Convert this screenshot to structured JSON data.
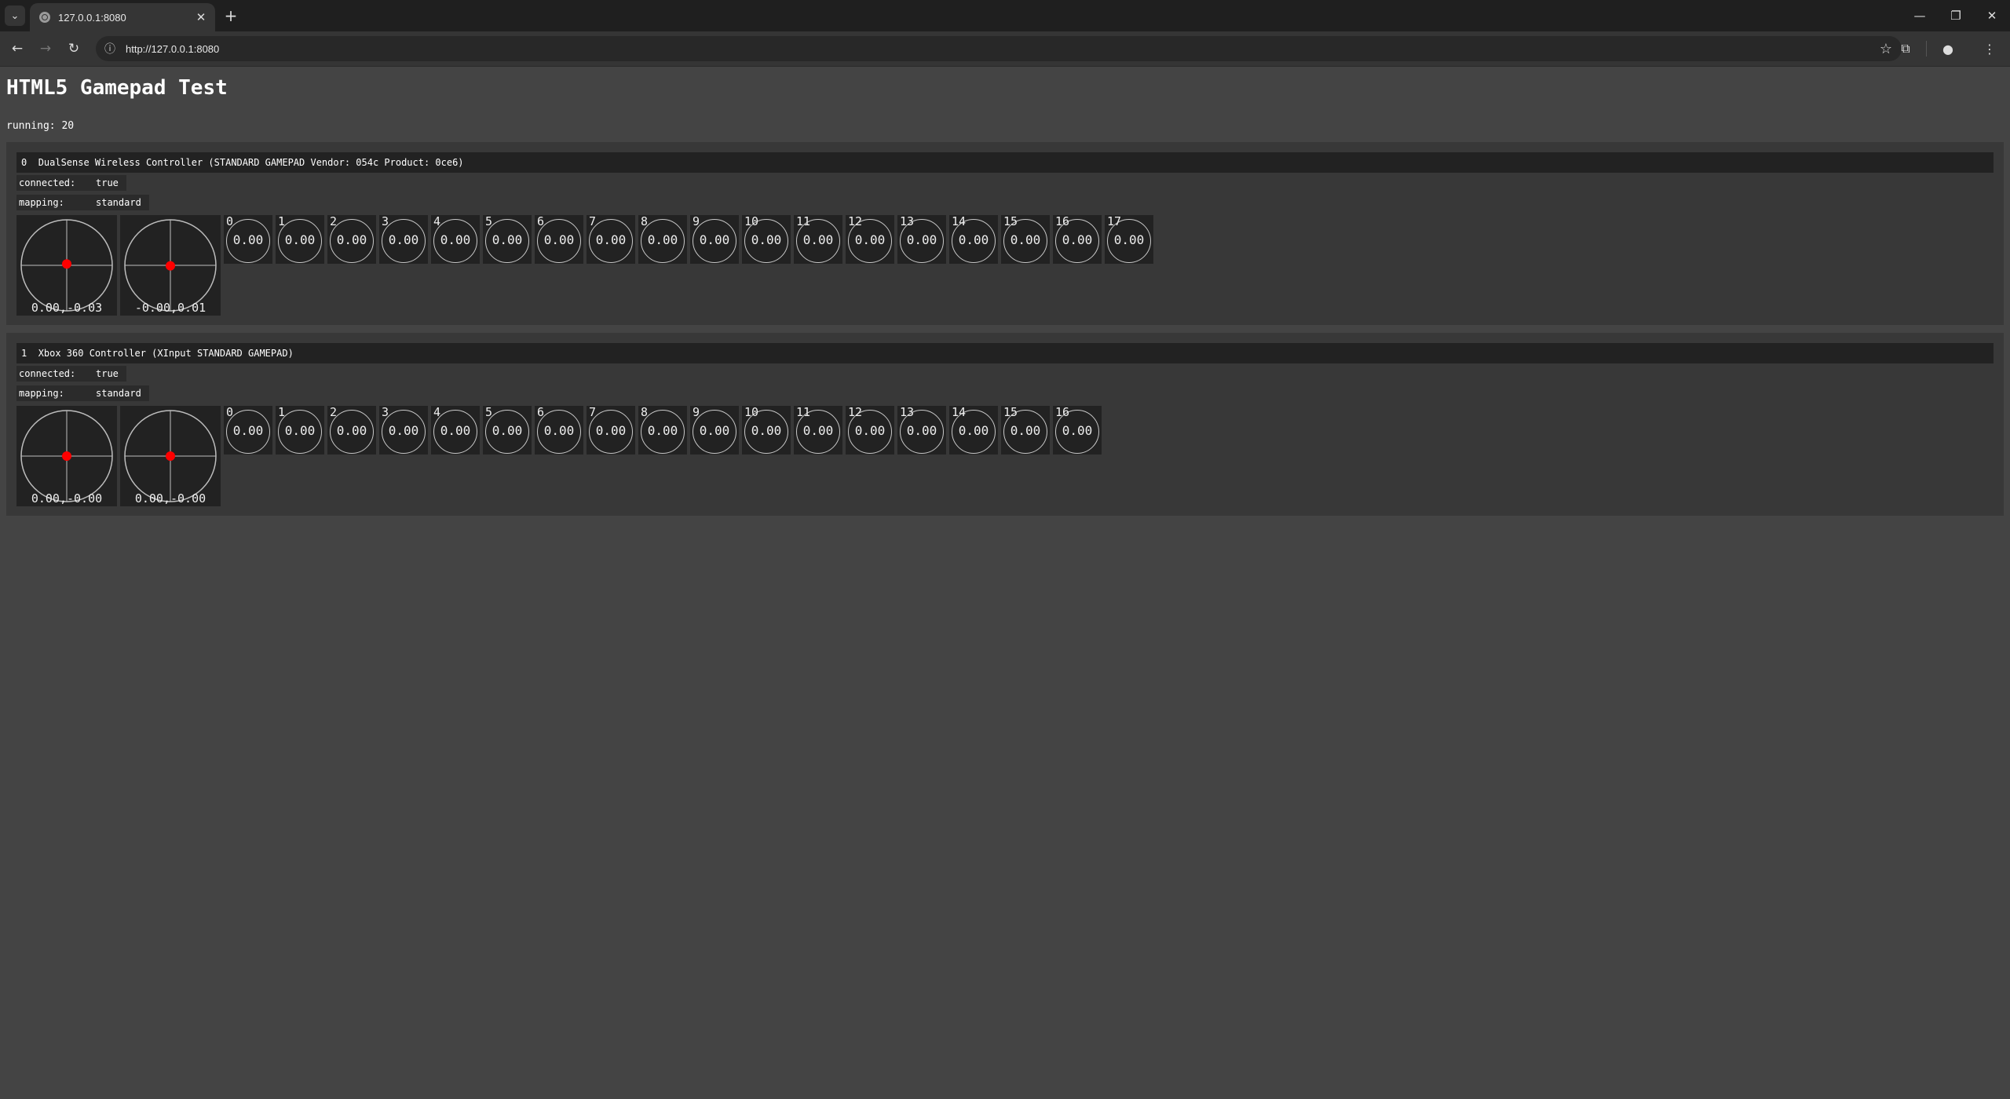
{
  "browser": {
    "tab_title": "127.0.0.1:8080",
    "url": "http://127.0.0.1:8080"
  },
  "page": {
    "title": "HTML5 Gamepad Test",
    "running": "running: 20"
  },
  "gamepads": [
    {
      "index": "0",
      "id": "DualSense Wireless Controller (STANDARD GAMEPAD Vendor: 054c Product: 0ce6)",
      "connected_label": "connected:",
      "connected": "true",
      "mapping_label": "mapping:",
      "mapping": "standard",
      "axes": [
        {
          "x": 0.0,
          "y": -0.03,
          "label": "0.00,-0.03"
        },
        {
          "x": -0.0,
          "y": 0.01,
          "label": "-0.00,0.01"
        }
      ],
      "buttons": [
        "0.00",
        "0.00",
        "0.00",
        "0.00",
        "0.00",
        "0.00",
        "0.00",
        "0.00",
        "0.00",
        "0.00",
        "0.00",
        "0.00",
        "0.00",
        "0.00",
        "0.00",
        "0.00",
        "0.00",
        "0.00"
      ]
    },
    {
      "index": "1",
      "id": "Xbox 360 Controller (XInput STANDARD GAMEPAD)",
      "connected_label": "connected:",
      "connected": "true",
      "mapping_label": "mapping:",
      "mapping": "standard",
      "axes": [
        {
          "x": 0.0,
          "y": -0.0,
          "label": "0.00,-0.00"
        },
        {
          "x": 0.0,
          "y": -0.0,
          "label": "0.00,-0.00"
        }
      ],
      "buttons": [
        "0.00",
        "0.00",
        "0.00",
        "0.00",
        "0.00",
        "0.00",
        "0.00",
        "0.00",
        "0.00",
        "0.00",
        "0.00",
        "0.00",
        "0.00",
        "0.00",
        "0.00",
        "0.00",
        "0.00"
      ]
    }
  ],
  "colors": {
    "stick_dot": "#ff0000",
    "crosshair": "#bdbdbd"
  },
  "icons": {
    "tab_list": "chevron-down-icon",
    "favicon": "globe-icon",
    "close_tab": "close-icon",
    "new_tab": "plus-icon",
    "back": "arrow-left-icon",
    "forward": "arrow-right-icon",
    "reload": "reload-icon",
    "site_info": "info-icon",
    "bookmark": "star-icon",
    "extensions": "puzzle-icon",
    "profile": "person-icon",
    "menu": "kebab-menu-icon"
  }
}
